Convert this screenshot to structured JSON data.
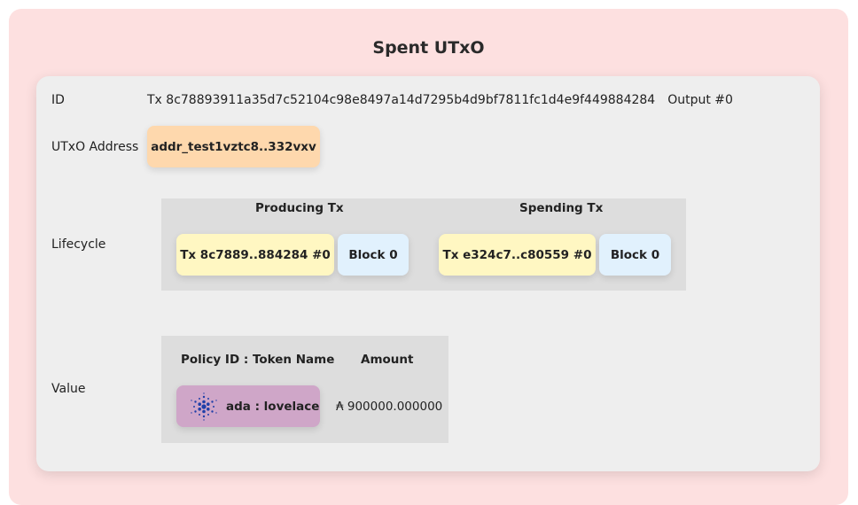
{
  "title": "Spent UTxO",
  "id_row": {
    "label": "ID",
    "tx": "Tx 8c78893911a35d7c52104c98e8497a14d7295b4d9bf7811fc1d4e9f449884284",
    "output": "Output #0"
  },
  "address_row": {
    "label": "UTxO Address",
    "address": "addr_test1vztc8..332vxv"
  },
  "lifecycle": {
    "label": "Lifecycle",
    "producing": {
      "heading": "Producing Tx",
      "tx": "Tx 8c7889..884284  #0",
      "block": "Block 0"
    },
    "spending": {
      "heading": "Spending Tx",
      "tx": "Tx e324c7..c80559  #0",
      "block": "Block 0"
    }
  },
  "value": {
    "label": "Value",
    "col_token": "Policy ID : Token Name",
    "col_amount": "Amount",
    "rows": [
      {
        "token": "ada : lovelace",
        "amount": "₳ 900000.000000",
        "icon": "cardano-icon"
      }
    ]
  },
  "colors": {
    "outer_bg": "#fde0e0",
    "card_bg": "#eeeeee",
    "panel_bg": "#dddddd",
    "address_chip": "#fed8ad",
    "tx_chip": "#fff7c2",
    "block_chip": "#e1f1fd",
    "token_chip": "#cfa6c8",
    "cardano_blue": "#1f3fa8"
  }
}
